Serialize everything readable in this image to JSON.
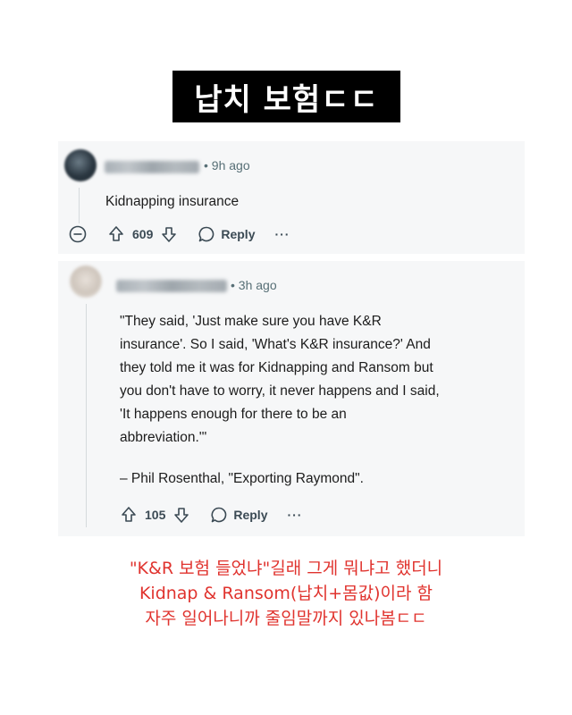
{
  "title": "납치 보험ㄷㄷ",
  "comment1": {
    "time": "• 9h ago",
    "body": "Kidnapping insurance",
    "votes": "609",
    "reply_label": "Reply",
    "more_label": "···"
  },
  "comment2": {
    "time": "• 3h ago",
    "lines": [
      "\"They said, 'Just make sure you have K&R",
      "insurance'. So I said, 'What's K&R insurance?' And",
      "they told me it was for Kidnapping and Ransom but",
      "you don't have to worry, it never happens and I said,",
      "'It happens enough for there to be an",
      "abbreviation.'\""
    ],
    "attribution": "– Phil Rosenthal, \"Exporting Raymond\".",
    "votes": "105",
    "reply_label": "Reply",
    "more_label": "···"
  },
  "caption": [
    "\"K&R 보험 들었냐\"길래 그게 뭐냐고 했더니",
    "Kidnap & Ransom(납치+몸값)이라 함",
    "자주 일어나니까 줄임말까지 있나봄ㄷㄷ"
  ]
}
